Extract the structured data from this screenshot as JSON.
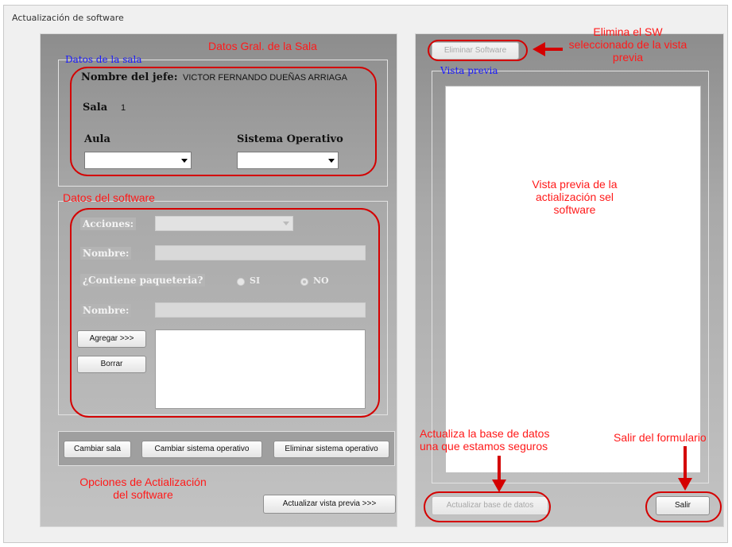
{
  "window": {
    "title": "Actualización de software"
  },
  "sala_group": {
    "title": "Datos de la sala",
    "jefe_label": "Nombre del jefe:",
    "jefe_value": "VICTOR FERNANDO DUEÑAS ARRIAGA",
    "sala_label": "Sala",
    "sala_value": "1",
    "aula_label": "Aula",
    "so_label": "Sistema Operativo",
    "aula_value": "",
    "so_value": ""
  },
  "software_group": {
    "acciones_label": "Acciones:",
    "nombre_label": "Nombre:",
    "paqueteria_label": "¿Contiene paqueteria?",
    "si_label": "SI",
    "no_label": "NO",
    "nombre2_label": "Nombre:",
    "agregar_button": "Agregar >>>",
    "borrar_button": "Borrar"
  },
  "bottom_buttons": {
    "cambiar_sala": "Cambiar sala",
    "cambiar_so": "Cambiar sistema operativo",
    "eliminar_so": "Eliminar sistema operativo",
    "actualizar_vista": "Actualizar vista previa >>>"
  },
  "right_panel": {
    "eliminar_software": "Eliminar Software",
    "vista_previa_title": "Vista previa",
    "actualizar_bd": "Actualizar base de datos",
    "salir": "Salir"
  },
  "annotations": {
    "datos_gral": "Datos Gral. de la Sala",
    "datos_software": "Datos del software",
    "opciones_line1": "Opciones de Actialización",
    "opciones_line2": "del software",
    "elimina_line1": "Elimina el SW",
    "elimina_line2": "seleccionado de la vista",
    "elimina_line3": "previa",
    "vista_line1": "Vista previa de la",
    "vista_line2": "actialización sel",
    "vista_line3": "software",
    "actualiza_line1": "Actualiza la base de datos",
    "actualiza_line2": "una que estamos seguros",
    "salir_note": "Salir del formulario"
  },
  "colors": {
    "annotation_red": "#ff1a1a",
    "group_title_blue": "#1a1aff"
  },
  "icons": {
    "dropdown": "chevron-down-icon",
    "arrow": "red-arrow-icon"
  }
}
